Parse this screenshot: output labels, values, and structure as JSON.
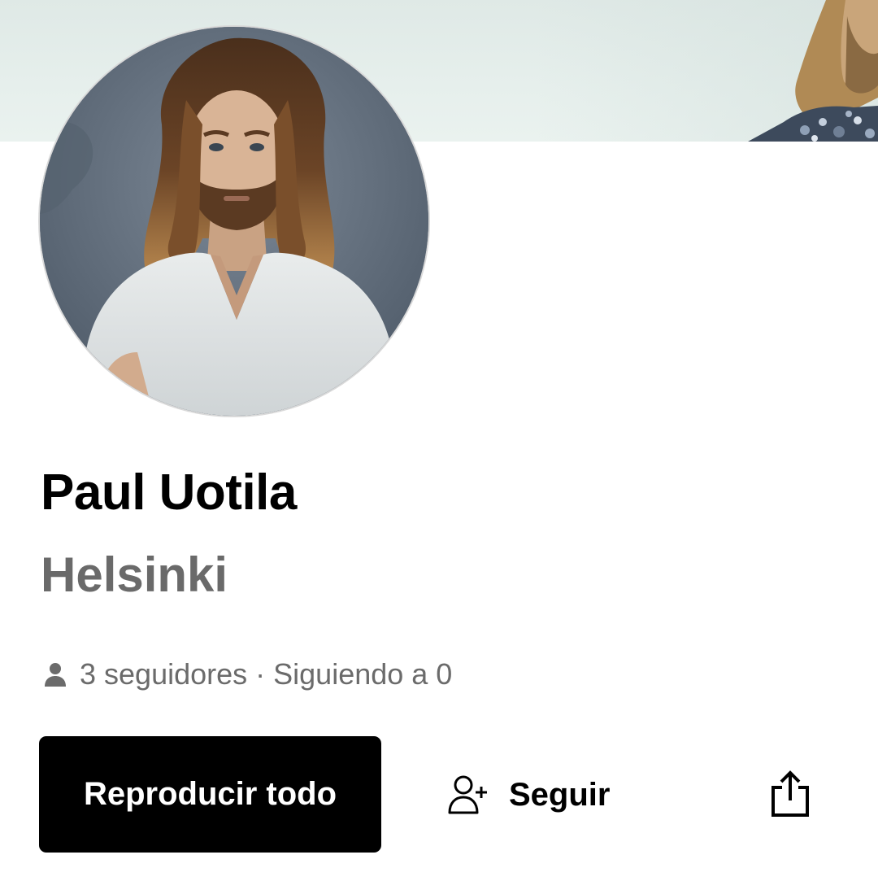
{
  "profile": {
    "name": "Paul Uotila",
    "location": "Helsinki"
  },
  "stats": {
    "followers_text": "3 seguidores",
    "separator": "·",
    "following_text": "Siguiendo a 0",
    "icon": "person-icon"
  },
  "actions": {
    "play_all_label": "Reproducir todo",
    "follow_label": "Seguir",
    "follow_icon": "add-person-icon",
    "share_icon": "share-icon"
  },
  "colors": {
    "primary_button_bg": "#000000",
    "primary_button_text": "#ffffff",
    "secondary_text": "#6a6a6a",
    "banner_bg": "#e3ece9"
  }
}
